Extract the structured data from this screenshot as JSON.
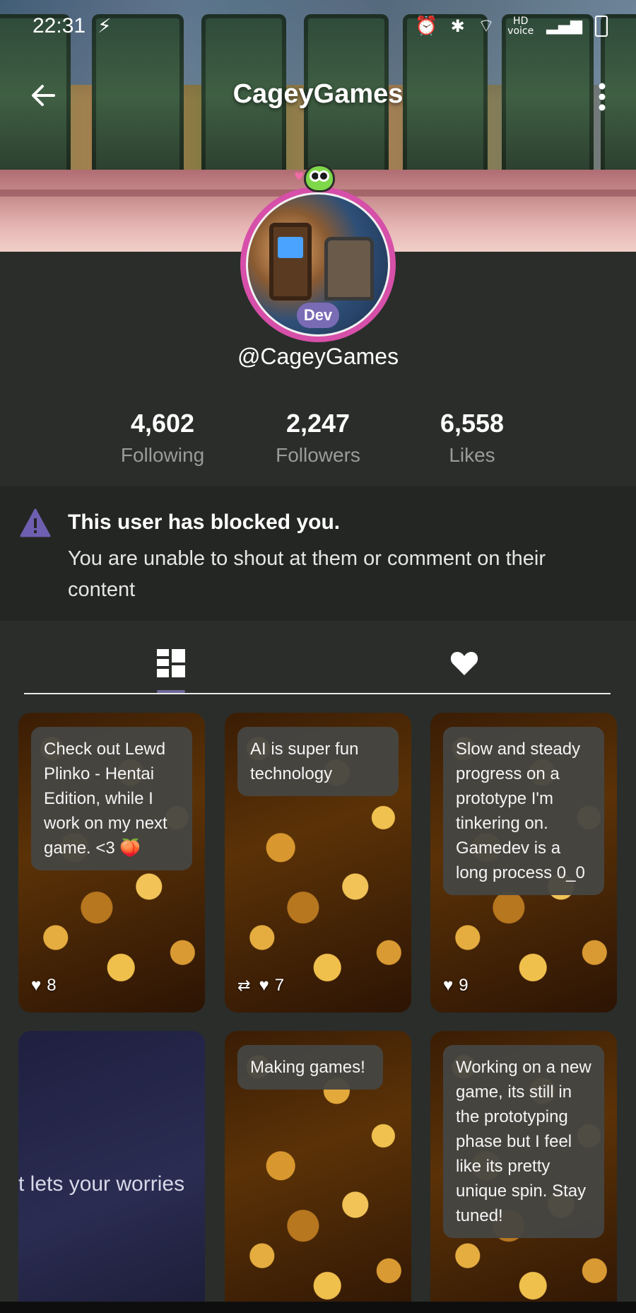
{
  "status_bar": {
    "time": "22:31",
    "icons": [
      "charging-bolt-icon",
      "alarm-icon",
      "bluetooth-icon",
      "wifi-icon",
      "hd-voice-icon",
      "signal-icon",
      "battery-icon"
    ]
  },
  "header": {
    "title": "CageyGames"
  },
  "profile": {
    "badge": "Dev",
    "handle": "@CageyGames",
    "stats": [
      {
        "value": "4,602",
        "label": "Following"
      },
      {
        "value": "2,247",
        "label": "Followers"
      },
      {
        "value": "6,558",
        "label": "Likes"
      }
    ]
  },
  "blocked_notice": {
    "title": "This user has blocked you.",
    "message": "You are unable to shout at them or comment on their content"
  },
  "tabs": [
    {
      "name": "posts",
      "icon": "grid-icon",
      "active": true
    },
    {
      "name": "likes",
      "icon": "heart-icon",
      "active": false
    }
  ],
  "posts": [
    {
      "text": "Check out Lewd Plinko - Hentai Edition, while I work on my next game. <3 🍑",
      "likes": "8",
      "repost": false
    },
    {
      "text": "AI is super fun technology",
      "likes": "7",
      "repost": true
    },
    {
      "text": "Slow and steady progress on a prototype I'm tinkering on. Gamedev is a long process 0_0",
      "likes": "9",
      "repost": false
    },
    {
      "text": "",
      "overlay": "t lets your worries",
      "likes": "",
      "repost": false
    },
    {
      "text": "Making games!",
      "likes": "",
      "repost": false
    },
    {
      "text": "Working on a new game, its still in the prototyping phase but I feel like its pretty unique spin. Stay tuned!",
      "likes": "",
      "repost": false
    }
  ],
  "colors": {
    "background": "#2a2d2a",
    "notice_background": "#242623",
    "accent_purple": "#7a6bb5",
    "avatar_ring": "#d64fa8",
    "warning_icon": "#6f5fb0"
  }
}
